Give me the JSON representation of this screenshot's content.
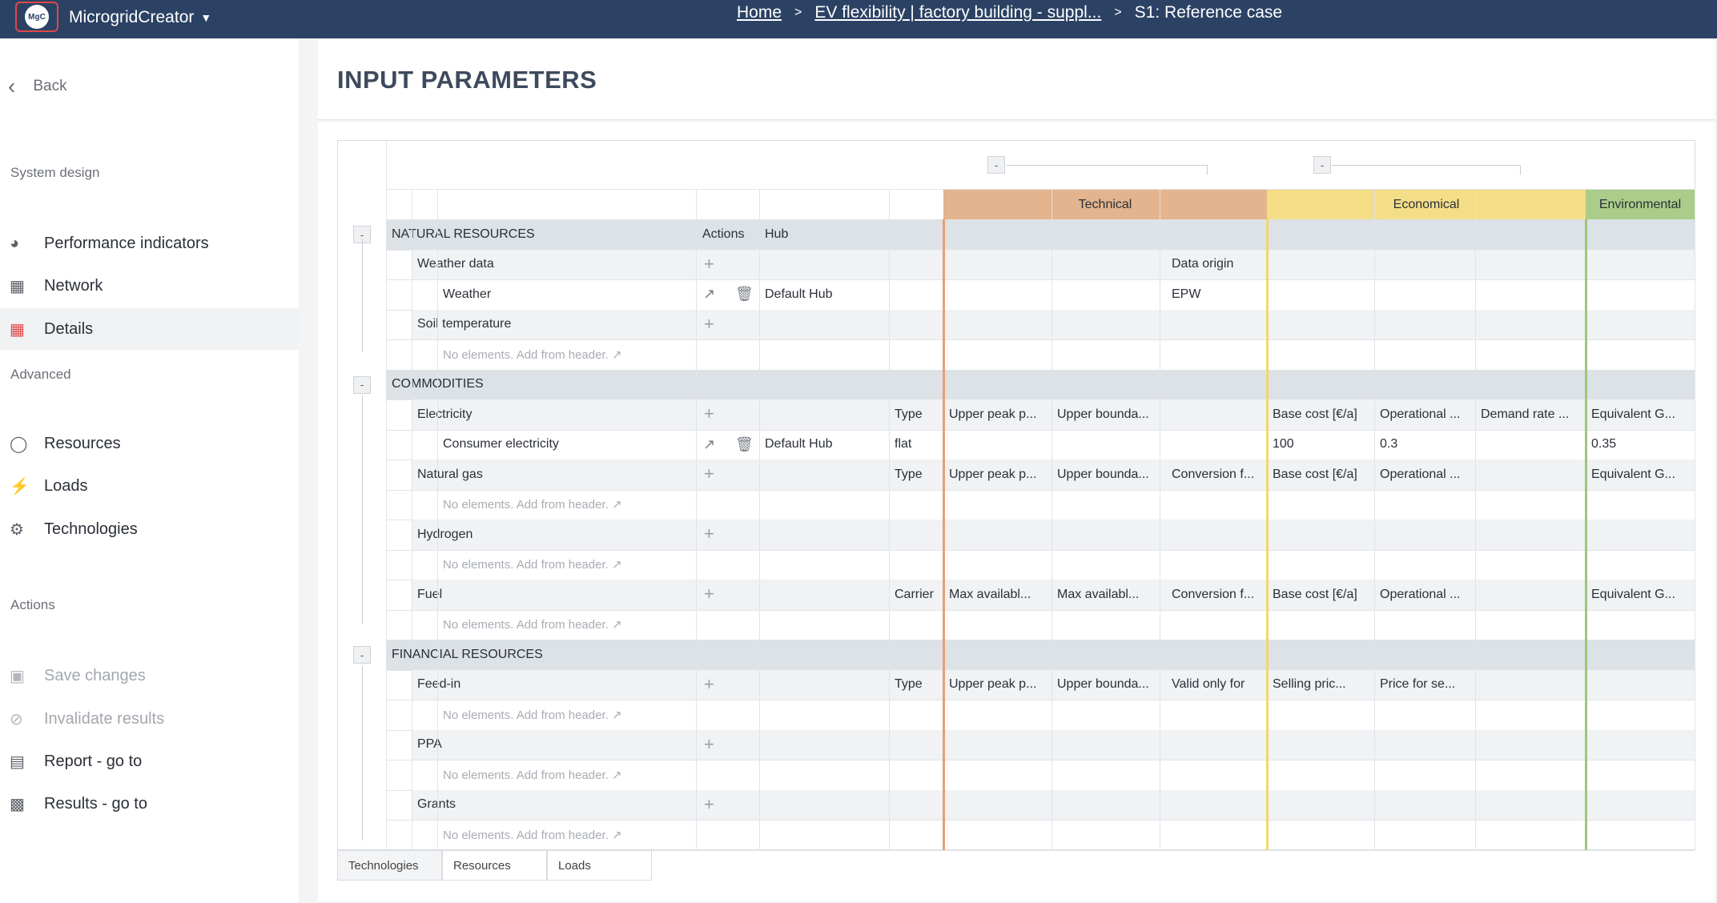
{
  "app": {
    "logo_text": "MgC",
    "name": "MicrogridCreator"
  },
  "breadcrumb": {
    "home": "Home",
    "project": "EV flexibility | factory building - suppl...",
    "current": "S1: Reference case"
  },
  "sidebar": {
    "back_label": "Back",
    "system_design_title": "System design",
    "system_items": [
      {
        "label": "Performance indicators",
        "icon": "pie-chart-icon"
      },
      {
        "label": "Network",
        "icon": "network-icon"
      },
      {
        "label": "Details",
        "icon": "table-icon",
        "active": true
      }
    ],
    "advanced_title": "Advanced",
    "advanced_items": [
      {
        "label": "Resources",
        "icon": "globe-icon"
      },
      {
        "label": "Loads",
        "icon": "bolt-icon"
      },
      {
        "label": "Technologies",
        "icon": "gears-icon"
      }
    ],
    "actions_title": "Actions",
    "action_items": [
      {
        "label": "Save changes",
        "icon": "save-icon",
        "disabled": true
      },
      {
        "label": "Invalidate results",
        "icon": "ban-icon",
        "disabled": true
      },
      {
        "label": "Report - go to",
        "icon": "report-icon"
      },
      {
        "label": "Results - go to",
        "icon": "bar-chart-icon"
      }
    ]
  },
  "page_title": "INPUT PARAMETERS",
  "grid": {
    "collapse_symbol": "-",
    "groups": {
      "technical": "Technical",
      "economical": "Economical",
      "environmental": "Environmental"
    },
    "colors": {
      "technical": "#e3b48e",
      "economical": "#f3dd87",
      "environmental": "#aacd8a",
      "tech_line": "#e8a070",
      "eco_line": "#f0d96a",
      "env_line": "#9cc77c",
      "section_bg": "#dde2e6",
      "sub_bg": "#f0f2f4"
    },
    "header": {
      "actions": "Actions",
      "hub": "Hub"
    },
    "placeholder": "No elements. Add from header. ↗",
    "sections": {
      "natural": "NATURAL RESOURCES",
      "commodities": "COMMODITIES",
      "financial": "FINANCIAL RESOURCES"
    },
    "rows": {
      "weather_data": "Weather data",
      "data_origin": "Data origin",
      "weather": "Weather",
      "weather_hub": "Default Hub",
      "weather_origin": "EPW",
      "soil": "Soil temperature",
      "electricity": "Electricity",
      "type": "Type",
      "upper_peak": "Upper peak p...",
      "upper_bound": "Upper bounda...",
      "base_cost": "Base cost [€/a]",
      "operational": "Operational ...",
      "demand_rate": "Demand rate ...",
      "equivalent": "Equivalent G...",
      "consumer": "Consumer electricity",
      "consumer_hub": "Default Hub",
      "consumer_type": "flat",
      "consumer_base": "100",
      "consumer_oper": "0.3",
      "consumer_equiv": "0.35",
      "natural_gas": "Natural gas",
      "conversion": "Conversion f...",
      "hydrogen": "Hydrogen",
      "fuel": "Fuel",
      "carrier": "Carrier",
      "max_avail1": "Max availabl...",
      "max_avail2": "Max availabl...",
      "feed_in": "Feed-in",
      "valid_only": "Valid only for",
      "selling_price": "Selling pric...",
      "price_for": "Price for se...",
      "ppa": "PPA",
      "grants": "Grants"
    }
  },
  "tabs": [
    "Technologies",
    "Resources",
    "Loads"
  ]
}
